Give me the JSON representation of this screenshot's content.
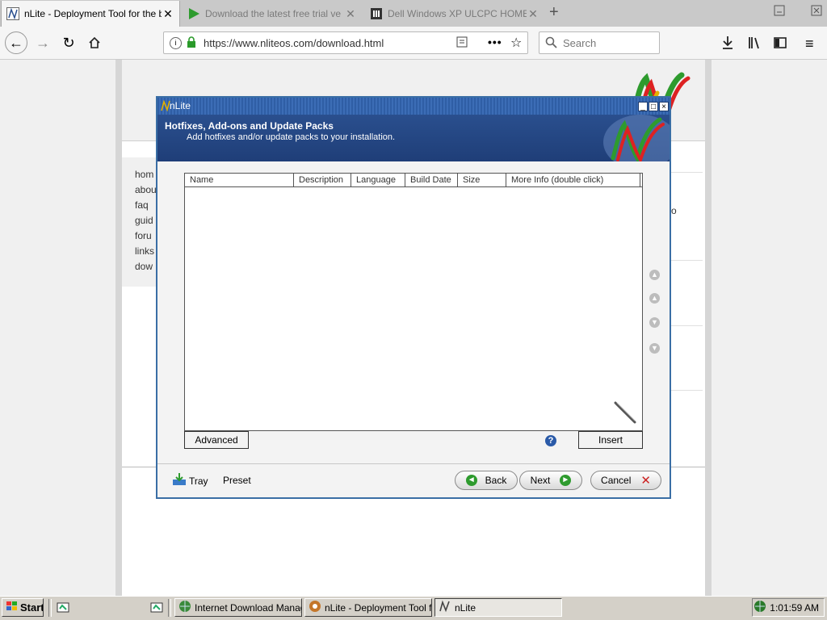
{
  "browser": {
    "tabs": [
      {
        "title": "nLite - Deployment Tool for the bo",
        "active": true
      },
      {
        "title": "Download the latest free trial ve",
        "active": false
      },
      {
        "title": "Dell Windows XP ULCPC HOME C",
        "active": false
      }
    ],
    "url": "https://www.nliteos.com/download.html",
    "search_placeholder": "Search"
  },
  "webpage": {
    "nav_links": [
      "hom",
      "abou",
      "faq",
      "guid",
      "foru",
      "links",
      "dow"
    ],
    "side_fragment": "o"
  },
  "dialog": {
    "title": "nLite",
    "header_title": "Hotfixes, Add-ons and Update Packs",
    "header_subtitle": "Add hotfixes and/or update packs to your installation.",
    "columns": [
      "Name",
      "Description",
      "Language",
      "Build Date",
      "Size",
      "More Info (double click)"
    ],
    "advanced_label": "Advanced",
    "insert_label": "Insert",
    "tray_label": "Tray",
    "preset_label": "Preset",
    "back_label": "Back",
    "next_label": "Next",
    "cancel_label": "Cancel"
  },
  "taskbar": {
    "start_label": "Start",
    "items": [
      {
        "label": "Internet Download Manag..."
      },
      {
        "label": "nLite - Deployment Tool fo..."
      },
      {
        "label": "nLite"
      }
    ],
    "clock": "1:01:59 AM"
  },
  "colors": {
    "dialog_header": "#1f3e78",
    "dialog_border": "#3a6ea5",
    "taskbar": "#d4d0c8",
    "next_icon": "#2e9b2e",
    "cancel_icon": "#cc2222"
  }
}
